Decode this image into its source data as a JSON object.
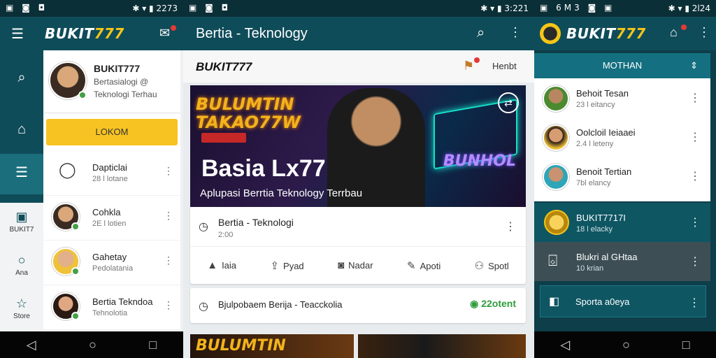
{
  "screen1": {
    "status": {
      "left": "▣ ◙ ◘",
      "right": "✱ ▾ ▮ 2273"
    },
    "brand": {
      "main": "BUKIT",
      "accent": "777"
    },
    "rail": [
      {
        "icon": "search-icon",
        "glyph": "⌕"
      },
      {
        "icon": "home-icon",
        "glyph": "⌂"
      },
      {
        "icon": "news-icon",
        "glyph": "☰"
      }
    ],
    "rail_lite": [
      {
        "icon": "store-icon",
        "glyph": "▣",
        "label": "BUKIT7"
      },
      {
        "icon": "search-icon",
        "glyph": "○",
        "label": "Ana"
      },
      {
        "icon": "star-icon",
        "glyph": "☆",
        "label": "Store"
      }
    ],
    "profile": {
      "name": "BUKIT777",
      "line1": "Bertasialogi @",
      "line2": "Teknologi Terhau"
    },
    "login_label": "LOKOM",
    "contacts": [
      {
        "name": "Dapticlai",
        "sub": "28 l lotane"
      },
      {
        "name": "Cohkla",
        "sub": "2E l lotien"
      },
      {
        "name": "Gahetay",
        "sub": "Pedolatania"
      },
      {
        "name": "Bertia Tekndoa",
        "sub": "Tehnolotia"
      }
    ]
  },
  "screen2": {
    "status": {
      "left": "▣ ◙ ◘",
      "right": "✱ ▾ ▮ 3:221"
    },
    "title": "Bertia - Teknology",
    "header_brand": "BUKIT777",
    "header_action": "Henbt",
    "hero": {
      "neon_text": "BULUMTIN\nTAKAO77W",
      "neon_right": "BUNHOL",
      "title": "Basia Lx77",
      "subtitle": "Aplupasi Berrtia Teknology Terrbau"
    },
    "post": {
      "title": "Bertia - Teknologi",
      "time": "2:00"
    },
    "actions": [
      {
        "icon": "like-icon",
        "glyph": "👍",
        "label": "Iaia"
      },
      {
        "icon": "share-box-icon",
        "glyph": "⇪",
        "label": "Pyad"
      },
      {
        "icon": "chat-icon",
        "glyph": "◙",
        "label": "Nadar"
      },
      {
        "icon": "pen-icon",
        "glyph": "✎",
        "label": "Apoti"
      },
      {
        "icon": "users-icon",
        "glyph": "⚇",
        "label": "Spotl"
      }
    ],
    "bar": {
      "text": "Bjulpobaem Berija - Teacckolia",
      "badge": "22otent"
    },
    "thumb_text": "BULUMTIN"
  },
  "screen3": {
    "status": {
      "left": "▣ 6M3 ◙ ▣",
      "right": "✱ ▾ ▮ 2l24"
    },
    "brand": {
      "main": "BUKIT",
      "accent": "777"
    },
    "menu_label": "MOTHAN",
    "people": [
      {
        "name": "Behoit Tesan",
        "sub": "23 l eitancy"
      },
      {
        "name": "Oolcloil Ieiaaei",
        "sub": "2.4 l leteny"
      },
      {
        "name": "Benoit Tertian",
        "sub": "7bl elancy"
      }
    ],
    "dark_items": [
      {
        "name": "BUKIT7717I",
        "sub": "18 l elacky"
      },
      {
        "name": "Blukri al GHtaa",
        "sub": "10 krian"
      }
    ],
    "sports_label": "Sporta a0eya",
    "bottom_text": "..."
  }
}
